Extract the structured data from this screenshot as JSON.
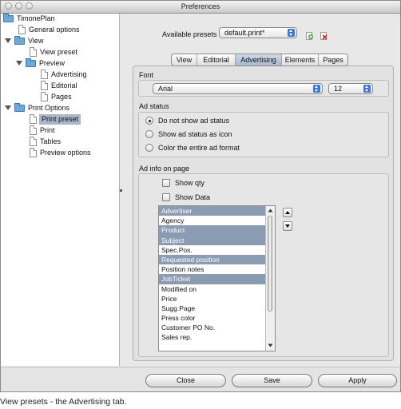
{
  "window": {
    "title": "Preferences"
  },
  "sidebar": {
    "items": [
      {
        "label": "TimonePlan"
      },
      {
        "label": "General options"
      },
      {
        "label": "View"
      },
      {
        "label": "View preset"
      },
      {
        "label": "Preview"
      },
      {
        "label": "Advertising"
      },
      {
        "label": "Editorial"
      },
      {
        "label": "Pages"
      },
      {
        "label": "Print Options"
      },
      {
        "label": "Print preset"
      },
      {
        "label": "Print"
      },
      {
        "label": "Tables"
      },
      {
        "label": "Preview options"
      }
    ]
  },
  "presets": {
    "label": "Available presets",
    "value": "default.print*"
  },
  "tabs": [
    "View",
    "Editorial",
    "Advertising",
    "Elements",
    "Pages"
  ],
  "font": {
    "header": "Font",
    "family": "Arial",
    "size": "12"
  },
  "ad_status": {
    "header": "Ad status",
    "options": [
      "Do not show ad status",
      "Show ad status as icon",
      "Color the entire ad format"
    ],
    "selected_index": 0
  },
  "ad_info": {
    "header": "Ad info on page",
    "show_qty": "Show qty",
    "show_data": "Show Data",
    "items": [
      {
        "label": "Advertiser",
        "selected": true
      },
      {
        "label": "Agency",
        "selected": false
      },
      {
        "label": "Product",
        "selected": true
      },
      {
        "label": "Subject",
        "selected": true
      },
      {
        "label": "Spec.Pos.",
        "selected": false
      },
      {
        "label": "Requested position",
        "selected": true
      },
      {
        "label": "Position notes",
        "selected": false
      },
      {
        "label": "JobTicket",
        "selected": true
      },
      {
        "label": "Modified on",
        "selected": false
      },
      {
        "label": "Price",
        "selected": false
      },
      {
        "label": "Sugg.Page",
        "selected": false
      },
      {
        "label": "Press color",
        "selected": false
      },
      {
        "label": "Customer PO No.",
        "selected": false
      },
      {
        "label": "Sales rep.",
        "selected": false
      }
    ]
  },
  "buttons": {
    "close": "Close",
    "save": "Save",
    "apply": "Apply"
  },
  "caption": "View presets - the Advertising tab.",
  "colors": {
    "selection": "#8b9cb2",
    "folder": "#6ea7d8",
    "stepper": "#3b78d6"
  }
}
